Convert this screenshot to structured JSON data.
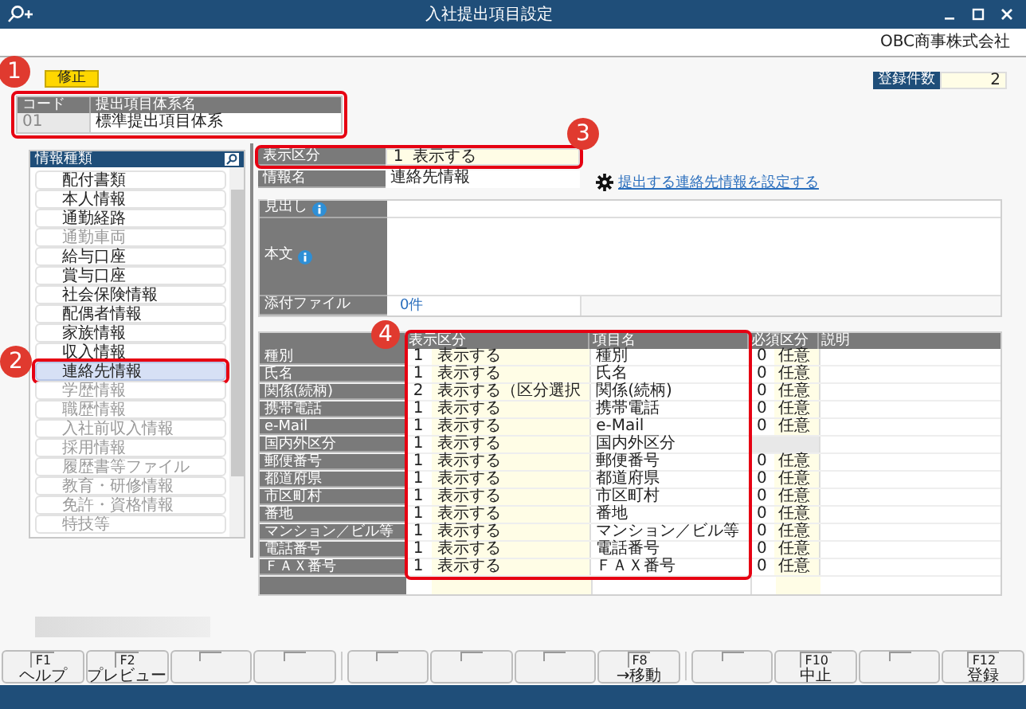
{
  "window": {
    "title": "入社提出項目設定"
  },
  "company": "OBC商事株式会社",
  "mode_badge": "修正",
  "record_count": {
    "label": "登録件数",
    "value": "2"
  },
  "code_table": {
    "callout": "1",
    "columns": [
      "コード",
      "提出項目体系名"
    ],
    "code": "01",
    "name": "標準提出項目体系"
  },
  "sidebar": {
    "title": "情報種類",
    "callout": "2",
    "items": [
      {
        "label": "配付書類",
        "disabled": false,
        "selected": false
      },
      {
        "label": "本人情報",
        "disabled": false,
        "selected": false
      },
      {
        "label": "通勤経路",
        "disabled": false,
        "selected": false
      },
      {
        "label": "通勤車両",
        "disabled": true,
        "selected": false
      },
      {
        "label": "給与口座",
        "disabled": false,
        "selected": false
      },
      {
        "label": "賞与口座",
        "disabled": false,
        "selected": false
      },
      {
        "label": "社会保険情報",
        "disabled": false,
        "selected": false
      },
      {
        "label": "配偶者情報",
        "disabled": false,
        "selected": false
      },
      {
        "label": "家族情報",
        "disabled": false,
        "selected": false
      },
      {
        "label": "収入情報",
        "disabled": false,
        "selected": false
      },
      {
        "label": "連絡先情報",
        "disabled": false,
        "selected": true
      },
      {
        "label": "学歴情報",
        "disabled": true,
        "selected": false
      },
      {
        "label": "職歴情報",
        "disabled": true,
        "selected": false
      },
      {
        "label": "入社前収入情報",
        "disabled": true,
        "selected": false
      },
      {
        "label": "採用情報",
        "disabled": true,
        "selected": false
      },
      {
        "label": "履歴書等ファイル",
        "disabled": true,
        "selected": false
      },
      {
        "label": "教育・研修情報",
        "disabled": true,
        "selected": false
      },
      {
        "label": "免許・資格情報",
        "disabled": true,
        "selected": false
      },
      {
        "label": "特技等",
        "disabled": true,
        "selected": false
      }
    ]
  },
  "display_field": {
    "callout": "3",
    "label": "表示区分",
    "code": "1",
    "value": "表示する"
  },
  "info_name": {
    "label": "情報名",
    "value": "連絡先情報"
  },
  "settings_link": "提出する連絡先情報を設定する",
  "content_box": {
    "heading_label": "見出し",
    "body_label": "本文",
    "attachment_label": "添付ファイル",
    "attachment_value": "0件"
  },
  "grid": {
    "callout": "4",
    "columns": [
      "表示区分",
      "項目名",
      "必須区分",
      "説明"
    ],
    "rows": [
      {
        "label": "種別",
        "display_code": "1",
        "display": "表示する",
        "item": "種別",
        "required_code": "0",
        "required": "任意"
      },
      {
        "label": "氏名",
        "display_code": "1",
        "display": "表示する",
        "item": "氏名",
        "required_code": "0",
        "required": "任意"
      },
      {
        "label": "関係(続柄)",
        "display_code": "2",
        "display": "表示する（区分選択",
        "item": "関係(続柄)",
        "required_code": "0",
        "required": "任意"
      },
      {
        "label": "携帯電話",
        "display_code": "1",
        "display": "表示する",
        "item": "携帯電話",
        "required_code": "0",
        "required": "任意"
      },
      {
        "label": "e-Mail",
        "display_code": "1",
        "display": "表示する",
        "item": "e-Mail",
        "required_code": "0",
        "required": "任意"
      },
      {
        "label": "国内外区分",
        "display_code": "1",
        "display": "表示する",
        "item": "国内外区分"
      },
      {
        "label": "郵便番号",
        "display_code": "1",
        "display": "表示する",
        "item": "郵便番号",
        "required_code": "0",
        "required": "任意"
      },
      {
        "label": "都道府県",
        "display_code": "1",
        "display": "表示する",
        "item": "都道府県",
        "required_code": "0",
        "required": "任意"
      },
      {
        "label": "市区町村",
        "display_code": "1",
        "display": "表示する",
        "item": "市区町村",
        "required_code": "0",
        "required": "任意"
      },
      {
        "label": "番地",
        "display_code": "1",
        "display": "表示する",
        "item": "番地",
        "required_code": "0",
        "required": "任意"
      },
      {
        "label": "マンション／ビル等",
        "display_code": "1",
        "display": "表示する",
        "item": "マンション／ビル等",
        "required_code": "0",
        "required": "任意"
      },
      {
        "label": "電話番号",
        "display_code": "1",
        "display": "表示する",
        "item": "電話番号",
        "required_code": "0",
        "required": "任意"
      },
      {
        "label": "ＦＡＸ番号",
        "display_code": "1",
        "display": "表示する",
        "item": "ＦＡＸ番号",
        "required_code": "0",
        "required": "任意"
      }
    ]
  },
  "function_keys": [
    {
      "kind": "key",
      "key": "F1",
      "label": "ヘルプ"
    },
    {
      "kind": "key",
      "key": "F2",
      "label": "プレビュー"
    },
    {
      "kind": "blank"
    },
    {
      "kind": "blank"
    },
    {
      "kind": "blank"
    },
    {
      "kind": "blank"
    },
    {
      "kind": "blank"
    },
    {
      "kind": "key",
      "key": "F8",
      "label": "→移動"
    },
    {
      "kind": "blank"
    },
    {
      "kind": "key",
      "key": "F10",
      "label": "中止"
    },
    {
      "kind": "blank"
    },
    {
      "kind": "key",
      "key": "F12",
      "label": "登録"
    }
  ]
}
